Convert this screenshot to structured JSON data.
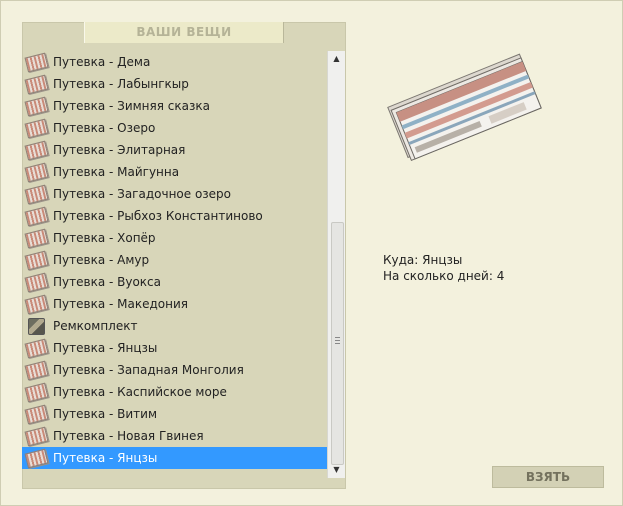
{
  "panel": {
    "header": "ВАШИ ВЕЩИ"
  },
  "items": [
    {
      "label": "Путевка - Дема",
      "icon": "ticket-icon"
    },
    {
      "label": "Путевка - Лабынгкыр",
      "icon": "ticket-icon"
    },
    {
      "label": "Путевка - Зимняя сказка",
      "icon": "ticket-icon"
    },
    {
      "label": "Путевка - Озеро",
      "icon": "ticket-icon"
    },
    {
      "label": "Путевка - Элитарная",
      "icon": "ticket-icon"
    },
    {
      "label": "Путевка - Майгунна",
      "icon": "ticket-icon"
    },
    {
      "label": "Путевка - Загадочное озеро",
      "icon": "ticket-icon"
    },
    {
      "label": "Путевка - Рыбхоз Константиново",
      "icon": "ticket-icon"
    },
    {
      "label": "Путевка - Хопёр",
      "icon": "ticket-icon"
    },
    {
      "label": "Путевка - Амур",
      "icon": "ticket-icon"
    },
    {
      "label": "Путевка - Вуокса",
      "icon": "ticket-icon"
    },
    {
      "label": "Путевка - Македония",
      "icon": "ticket-icon"
    },
    {
      "label": "Ремкомплект",
      "icon": "repair-kit-icon"
    },
    {
      "label": "Путевка - Янцзы",
      "icon": "ticket-icon"
    },
    {
      "label": "Путевка - Западная Монголия",
      "icon": "ticket-icon"
    },
    {
      "label": "Путевка - Каспийское море",
      "icon": "ticket-icon"
    },
    {
      "label": "Путевка - Витим",
      "icon": "ticket-icon"
    },
    {
      "label": "Путевка - Новая Гвинея",
      "icon": "ticket-icon"
    },
    {
      "label": "Путевка - Янцзы",
      "icon": "ticket-icon",
      "selected": true
    }
  ],
  "details": {
    "destination": "Куда: Янцзы",
    "days": "На сколько дней: 4"
  },
  "take_button": "ВЗЯТЬ"
}
